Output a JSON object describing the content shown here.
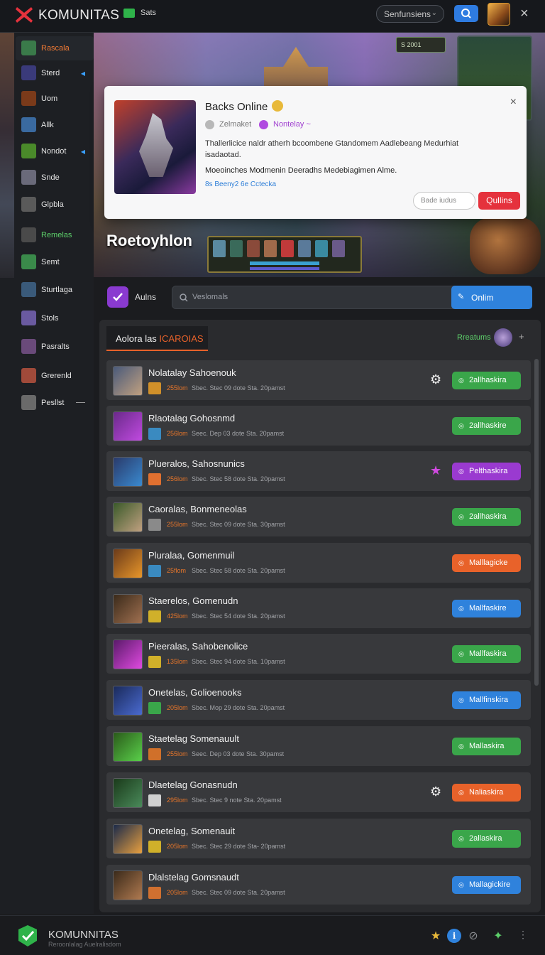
{
  "header": {
    "app_name": "KOMUNITAS",
    "badge_label": "Sats",
    "select_value": "Senfunsiens",
    "accent": "#2f82dc",
    "brand": "#e5323d"
  },
  "sidebar": {
    "items": [
      {
        "label": "Rascala",
        "icon": "game-icon",
        "color": "orange"
      },
      {
        "label": "Sterd",
        "icon": "sword-icon"
      },
      {
        "label": "Uom",
        "icon": "hero-icon"
      },
      {
        "label": "Allk",
        "icon": "blade-icon"
      },
      {
        "label": "Nondot",
        "icon": "leaf-icon"
      },
      {
        "label": "Snde",
        "icon": "gear-icon"
      },
      {
        "label": "Glpbla",
        "icon": "box-icon"
      },
      {
        "label": "Remelas",
        "icon": "flag-icon",
        "color": "green"
      },
      {
        "label": "Semt",
        "icon": "shield-icon"
      },
      {
        "label": "Sturtlaga",
        "icon": "map-icon"
      },
      {
        "label": "Stols",
        "icon": "crystal-icon"
      },
      {
        "label": "Pasralts",
        "icon": "character-icon"
      },
      {
        "label": "Grerenld",
        "icon": "fire-icon"
      },
      {
        "label": "Pesllst",
        "icon": "y-icon"
      }
    ]
  },
  "hero": {
    "title": "Roetoyhlon",
    "mini_label": "S 2001"
  },
  "modal": {
    "title": "Backs Online",
    "meta_1": "Zelmaket",
    "meta_2": "Nontelay ~",
    "description": "Thallerlicice naldr atherh bcoombene Gtandomem Aadlebeang Medurhiat isadaotad.",
    "description_2": "Moeoinches Modmenin Deeradhs Medebiagimen Alme.",
    "link": "8s Beeny2 6e Cctecka",
    "secondary_button": "Bade iudus",
    "primary_button": "Qullins"
  },
  "toolbar": {
    "feature_label": "Aulns",
    "search_placeholder": "Veslomals",
    "online_button": "Onlim"
  },
  "list": {
    "tab_prefix": "Aolora las ",
    "tab_highlight": "ICAROIAS",
    "count_label": "Rreatums",
    "rows": [
      {
        "name": "Nolatalay Sahoenouk",
        "stat": "255lom",
        "meta": "Sbec. Stec 09 dote Sta. 20pamst",
        "button": "2allhaskira",
        "color": "#3aa64a",
        "extra": "gear"
      },
      {
        "name": "Rlaotalag Gohosnmd",
        "stat": "256lom",
        "meta": "Seec. Dep 03 dote Sta. 20pamst",
        "button": "2allhaskire",
        "color": "#3aa64a",
        "extra": ""
      },
      {
        "name": "Plueralos, Sahosnunics",
        "stat": "256lom",
        "meta": "Sbec. Stec 58 dote Sta. 20pamst",
        "button": "Pelthaskira",
        "color": "#9a3ad0",
        "extra": "star"
      },
      {
        "name": "Caoralas, Bonmeneolas",
        "stat": "255lom",
        "meta": "Sbec. Stec 09 dote Sta. 30pamst",
        "button": "2allhaskira",
        "color": "#3aa64a",
        "extra": ""
      },
      {
        "name": "Pluralaa, Gomenmuil",
        "stat": "25flom",
        "meta": "Sbec. Stec 58 dote Sta. 20pamst",
        "button": "Malllagicke",
        "color": "#e8622a",
        "extra": ""
      },
      {
        "name": "Staerelos, Gomenudn",
        "stat": "425lom",
        "meta": "Sbec. Stec 54 dote Sta. 20pamst",
        "button": "Mallfaskire",
        "color": "#2f82dc",
        "extra": ""
      },
      {
        "name": "Pieeralas, Sahobenolice",
        "stat": "135lom",
        "meta": "Sbec. Stec 94 dote Sta. 10pamst",
        "button": "Mallfaskira",
        "color": "#3aa64a",
        "extra": ""
      },
      {
        "name": "Onetelas, Golioenooks",
        "stat": "205lom",
        "meta": "Sbec. Mop 29 dote Sta. 20pamst",
        "button": "Mallfinskira",
        "color": "#2f82dc",
        "extra": ""
      },
      {
        "name": "Staetelag Somenauult",
        "stat": "255lom",
        "meta": "Seec. Dep 03 dote Sta. 30pamst",
        "button": "Mallaskira",
        "color": "#3aa64a",
        "extra": ""
      },
      {
        "name": "Dlaetelag Gonasnudn",
        "stat": "295lom",
        "meta": "Sbec. Stec 9 note Sta. 20pamst",
        "button": "Naliaskira",
        "color": "#e8622a",
        "extra": "gear"
      },
      {
        "name": "Onetelag, Somenauit",
        "stat": "205lom",
        "meta": "Sbec. Stec 29 dote Sta- 20pamst",
        "button": "2allaskira",
        "color": "#3aa64a",
        "extra": ""
      },
      {
        "name": "Dlalstelag Gomsnaudt",
        "stat": "205lom",
        "meta": "Sbec. Stec 09 dote Sta. 20pamst",
        "button": "Mallagickire",
        "color": "#2f82dc",
        "extra": ""
      }
    ]
  },
  "footer": {
    "name": "KOMUNNITAS",
    "subtitle": "Reroonlalag Auelralisdom"
  }
}
